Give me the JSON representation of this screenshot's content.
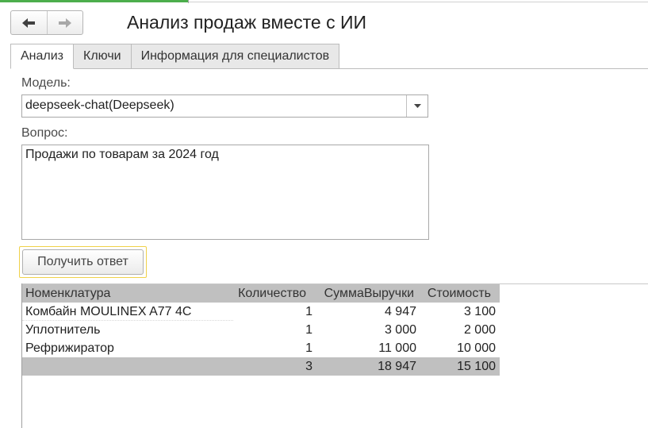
{
  "window": {
    "title": "Анализ продаж вместе с ИИ"
  },
  "nav": {
    "back_icon": "arrow-left",
    "forward_icon": "arrow-right"
  },
  "tabs": [
    {
      "label": "Анализ",
      "active": true
    },
    {
      "label": "Ключи",
      "active": false
    },
    {
      "label": "Информация для специалистов",
      "active": false
    }
  ],
  "form": {
    "model_label": "Модель:",
    "model_value": "deepseek-chat(Deepseek)",
    "question_label": "Вопрос:",
    "question_value": "Продажи по товарам за 2024 год",
    "submit_label": "Получить ответ"
  },
  "table": {
    "columns": [
      "Номенклатура",
      "Количество",
      "СуммаВыручки",
      "Стоимость"
    ],
    "rows": [
      [
        "Комбайн MOULINEX  A77 4C",
        "1",
        "4 947",
        "3 100"
      ],
      [
        "Уплотнитель",
        "1",
        "3 000",
        "2 000"
      ],
      [
        "Рефрижиратор",
        "1",
        "11 000",
        "10 000"
      ]
    ],
    "totals": [
      "",
      "3",
      "18 947",
      "15 100"
    ]
  },
  "colors": {
    "accent_green": "#4cae4c",
    "focus_border": "#f0d24a",
    "table_header": "#c0c0c0"
  }
}
